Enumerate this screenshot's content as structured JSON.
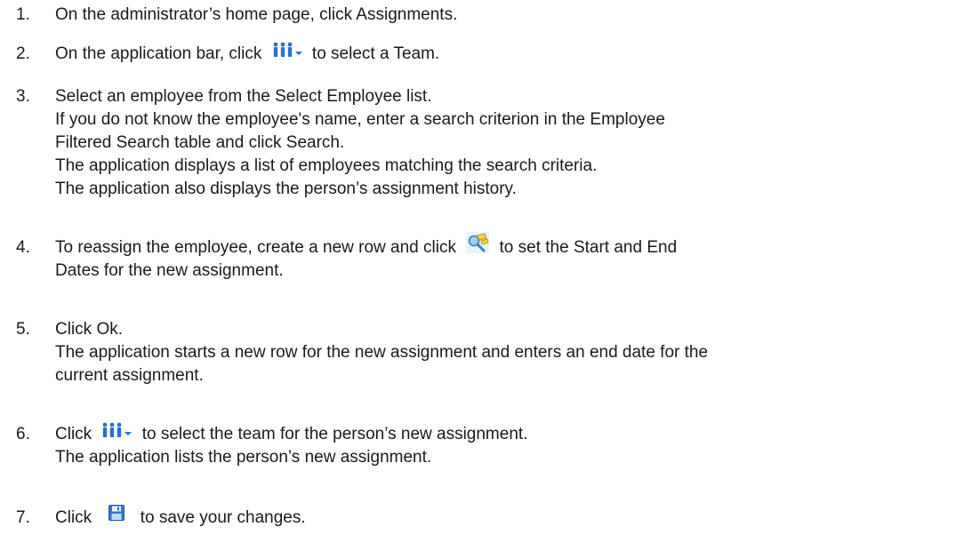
{
  "steps": [
    {
      "number": "1.",
      "lines": [
        "On the administrator’s home page, click Assignments."
      ]
    },
    {
      "number": "2.",
      "before_icon": "On the application bar, click",
      "icon": "team-selector-icon",
      "after_icon": "to select a Team."
    },
    {
      "number": "3.",
      "lines": [
        "Select an employee from the Select Employee list.",
        "If you do not know the employee's name, enter a search criterion in the Employee",
        "Filtered Search table and click Search.",
        "The application displays a list of employees matching the search criteria.",
        "The application also displays the person’s assignment history."
      ]
    },
    {
      "number": "4.",
      "before_icon": "To reassign the employee, create a new row and click",
      "icon": "date-edit-icon",
      "after_icon": "to set the Start and End",
      "lines": [
        "Dates for the new assignment."
      ]
    },
    {
      "number": "5.",
      "lines": [
        "Click Ok.",
        "The application starts a new row for the new assignment and enters an end date for the",
        "current assignment."
      ]
    },
    {
      "number": "6.",
      "before_icon": "Click",
      "icon": "team-selector-icon",
      "after_icon": "to select the team for the person’s new assignment.",
      "lines": [
        "The application lists the person’s new assignment."
      ]
    },
    {
      "number": "7.",
      "before_icon": "Click",
      "icon": "save-icon",
      "after_icon": "to save your changes."
    }
  ]
}
